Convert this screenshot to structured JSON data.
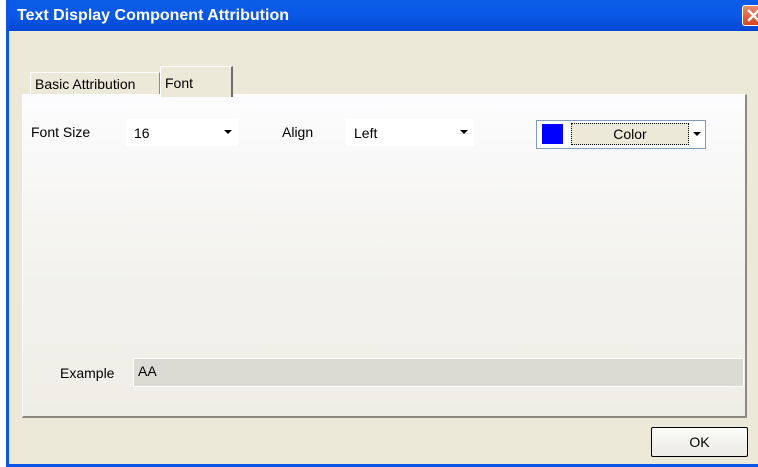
{
  "window": {
    "title": "Text Display Component Attribution"
  },
  "tabs": [
    {
      "label": "Basic Attribution",
      "active": false
    },
    {
      "label": "Font",
      "active": true
    }
  ],
  "font_tab": {
    "font_size_label": "Font Size",
    "font_size_value": "16",
    "align_label": "Align",
    "align_value": "Left",
    "color_button_label": "Color",
    "color_value": "#0000ff",
    "example_label": "Example",
    "example_text": "AA"
  },
  "footer": {
    "ok_label": "OK"
  },
  "icons": {
    "close": "close-icon",
    "dropdown": "chevron-down-icon"
  },
  "colors": {
    "titlebar": "#0a58e8",
    "dialog_bg": "#ece9d8",
    "close_button": "#d9421d"
  }
}
